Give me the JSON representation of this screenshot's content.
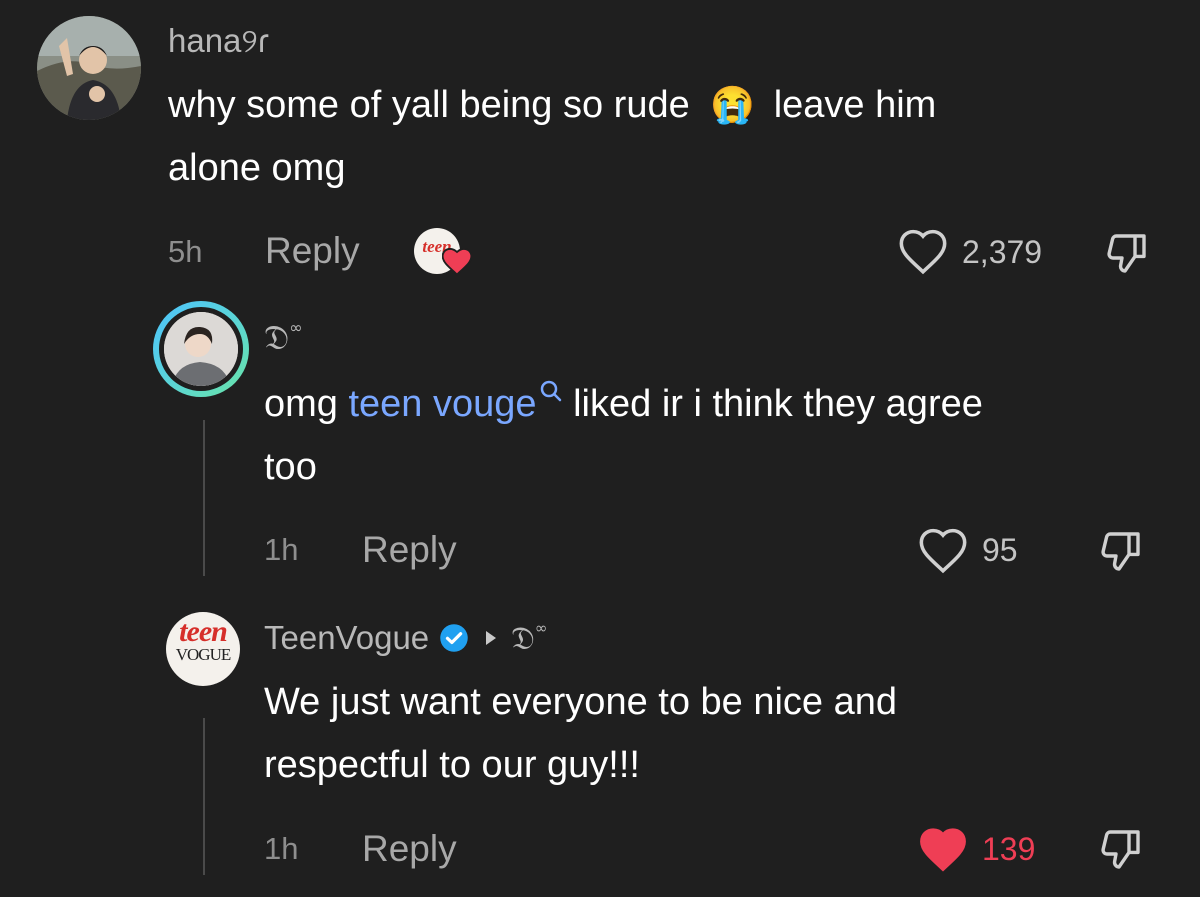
{
  "comments": [
    {
      "username": "hana୨ɾ",
      "text_line1": "why some of yall being so rude",
      "emoji": "😭",
      "text_line1b": "leave him",
      "text_line2": "alone omg",
      "time": "5h",
      "reply_label": "Reply",
      "creator_like_badge": "teen",
      "likes": "2,379",
      "liked": false
    },
    {
      "username": "𝔇",
      "username_sup": "∞",
      "text_pre": "omg ",
      "mention": "teen vouge",
      "text_post": " liked ir i think they agree",
      "text_line2": "too",
      "time": "1h",
      "reply_label": "Reply",
      "likes": "95",
      "liked": false
    },
    {
      "username": "TeenVogue",
      "reply_to": "𝔇",
      "reply_to_sup": "∞",
      "avatar_text_top": "teen",
      "avatar_text_bottom": "VOGUE",
      "text_line1": "We just want everyone to be nice and",
      "text_line2": "respectful to our guy!!!",
      "time": "1h",
      "reply_label": "Reply",
      "likes": "139",
      "liked": true
    }
  ],
  "icons": {
    "like": "heart-icon",
    "dislike": "thumbs-down-icon",
    "verified": "verified-badge-icon",
    "search": "search-icon",
    "reply_arrow": "reply-arrow-icon"
  },
  "colors": {
    "background": "#1f1f1f",
    "mention": "#7aa7ff",
    "liked_heart": "#ef3e55",
    "verified": "#20a0f0",
    "story_ring_start": "#4cc3ff",
    "story_ring_end": "#69e4a6"
  }
}
